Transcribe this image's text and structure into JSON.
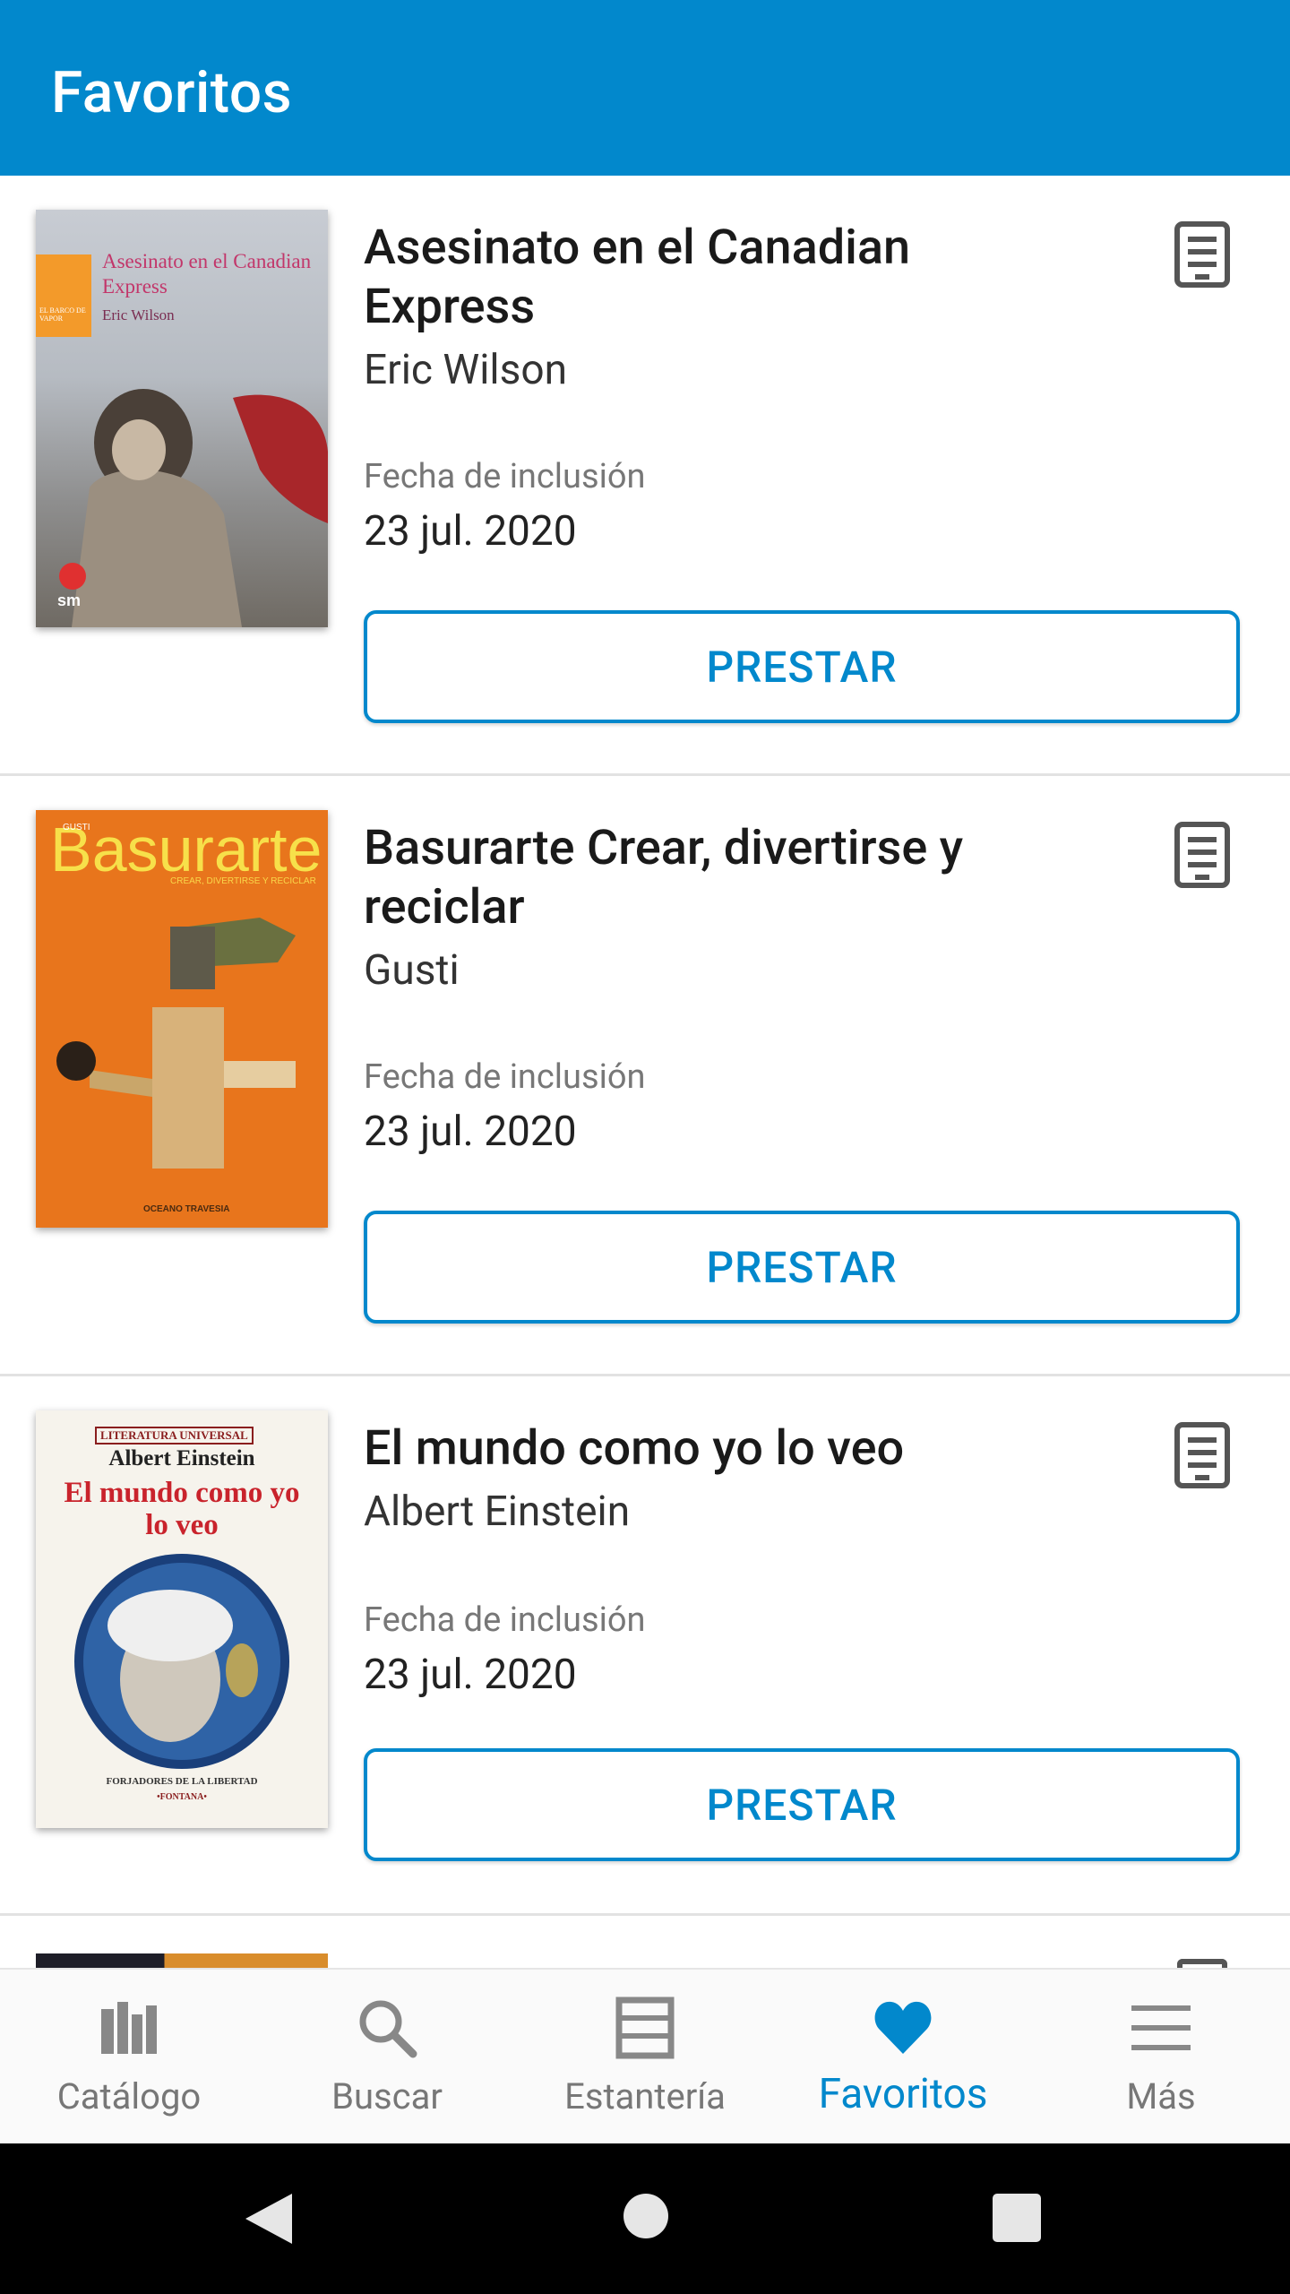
{
  "app_bar": {
    "title": "Favoritos"
  },
  "colors": {
    "primary": "#0288cc",
    "divider": "#e2e2e2"
  },
  "items": [
    {
      "title": "Asesinato en el Canadian Express",
      "author": "Eric Wilson",
      "inclusion_label": "Fecha de inclusión",
      "inclusion_date": "23 jul. 2020",
      "button_label": "PRESTAR",
      "cover_text": {
        "title": "Asesinato en el Canadian Express",
        "author": "Eric Wilson",
        "series": "EL BARCO DE VAPOR",
        "publisher": "sm"
      }
    },
    {
      "title": "Basurarte Crear, divertirse y reciclar",
      "author": "Gusti",
      "inclusion_label": "Fecha de inclusión",
      "inclusion_date": "23 jul. 2020",
      "button_label": "PRESTAR",
      "cover_text": {
        "title": "Basurarte",
        "subtitle": "CREAR, DIVERTIRSE Y RECICLAR",
        "author": "GUSTI",
        "publisher": "OCEANO TRAVESIA"
      }
    },
    {
      "title": "El mundo como yo lo veo",
      "author": "Albert Einstein",
      "inclusion_label": "Fecha de inclusión",
      "inclusion_date": "23 jul. 2020",
      "button_label": "PRESTAR",
      "cover_text": {
        "series": "LITERATURA UNIVERSAL",
        "author": "Albert Einstein",
        "title": "El mundo como yo lo veo",
        "collection": "FORJADORES DE LA LIBERTAD",
        "publisher": "•FONTANA•"
      }
    }
  ],
  "bottom_nav": [
    {
      "label": "Catálogo",
      "icon": "catalog-icon",
      "active": false
    },
    {
      "label": "Buscar",
      "icon": "search-icon",
      "active": false
    },
    {
      "label": "Estantería",
      "icon": "shelf-icon",
      "active": false
    },
    {
      "label": "Favoritos",
      "icon": "heart-icon",
      "active": true
    },
    {
      "label": "Más",
      "icon": "menu-icon",
      "active": false
    }
  ]
}
